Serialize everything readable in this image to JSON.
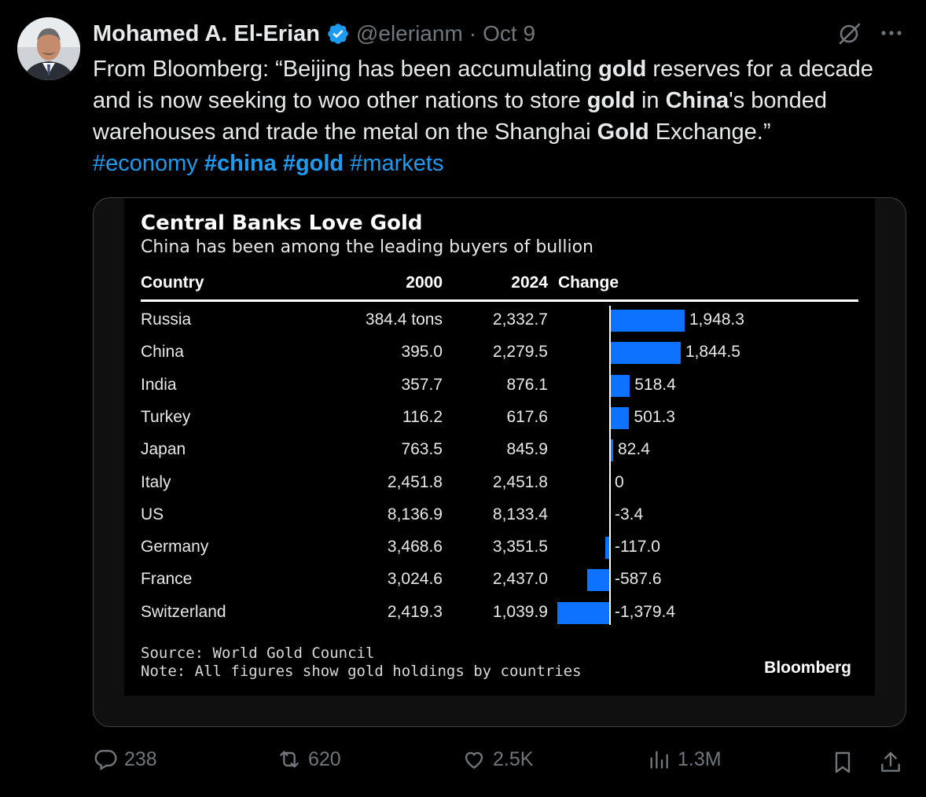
{
  "author": {
    "name": "Mohamed A. El-Erian",
    "handle": "@elerianm",
    "separator": "·",
    "date": "Oct 9"
  },
  "tweet": {
    "segments": [
      {
        "text": "From Bloomberg: “Beijing has been accumulating ",
        "style": "normal"
      },
      {
        "text": "gold",
        "style": "bold"
      },
      {
        "text": " reserves for a decade and is now seeking to woo other nations to store ",
        "style": "normal"
      },
      {
        "text": "gold",
        "style": "bold"
      },
      {
        "text": " in ",
        "style": "normal"
      },
      {
        "text": "China",
        "style": "bold"
      },
      {
        "text": "'s bonded warehouses and trade the metal on the Shanghai ",
        "style": "normal"
      },
      {
        "text": "Gold",
        "style": "bold"
      },
      {
        "text": " Exchange.”",
        "style": "normal"
      }
    ],
    "hashtags": [
      {
        "text": "#economy",
        "bold": false
      },
      {
        "text": "#china",
        "bold": true
      },
      {
        "text": "#gold",
        "bold": true
      },
      {
        "text": "#markets",
        "bold": false
      }
    ]
  },
  "chart_data": {
    "type": "table",
    "title": "Central Banks Love Gold",
    "subtitle": "China has been among the leading buyers of bullion",
    "columns": [
      "Country",
      "2000",
      "2024",
      "Change"
    ],
    "rows": [
      {
        "country": "Russia",
        "y2000": "384.4 tons",
        "y2024": "2,332.7",
        "change": 1948.3,
        "change_label": "1,948.3"
      },
      {
        "country": "China",
        "y2000": "395.0",
        "y2024": "2,279.5",
        "change": 1844.5,
        "change_label": "1,844.5"
      },
      {
        "country": "India",
        "y2000": "357.7",
        "y2024": "876.1",
        "change": 518.4,
        "change_label": "518.4"
      },
      {
        "country": "Turkey",
        "y2000": "116.2",
        "y2024": "617.6",
        "change": 501.3,
        "change_label": "501.3"
      },
      {
        "country": "Japan",
        "y2000": "763.5",
        "y2024": "845.9",
        "change": 82.4,
        "change_label": "82.4"
      },
      {
        "country": "Italy",
        "y2000": "2,451.8",
        "y2024": "2,451.8",
        "change": 0,
        "change_label": "0"
      },
      {
        "country": "US",
        "y2000": "8,136.9",
        "y2024": "8,133.4",
        "change": -3.4,
        "change_label": "-3.4"
      },
      {
        "country": "Germany",
        "y2000": "3,468.6",
        "y2024": "3,351.5",
        "change": -117.0,
        "change_label": "-117.0"
      },
      {
        "country": "France",
        "y2000": "3,024.6",
        "y2024": "2,437.0",
        "change": -587.6,
        "change_label": "-587.6"
      },
      {
        "country": "Switzerland",
        "y2000": "2,419.3",
        "y2024": "1,039.9",
        "change": -1379.4,
        "change_label": "-1,379.4"
      }
    ],
    "source": "Source: World Gold Council",
    "note": "Note: All figures show gold holdings by countries",
    "brand": "Bloomberg",
    "bar_color": "#0d72ff"
  },
  "actions": {
    "replies": "238",
    "reposts": "620",
    "likes": "2.5K",
    "views": "1.3M"
  },
  "colors": {
    "background": "#000000",
    "text": "#e7e9ea",
    "muted": "#71767b",
    "accent": "#1d9bf0"
  },
  "icons": [
    "verified-badge-icon",
    "grok-icon",
    "more-icon",
    "reply-icon",
    "repost-icon",
    "like-icon",
    "views-icon",
    "bookmark-icon",
    "share-icon"
  ]
}
